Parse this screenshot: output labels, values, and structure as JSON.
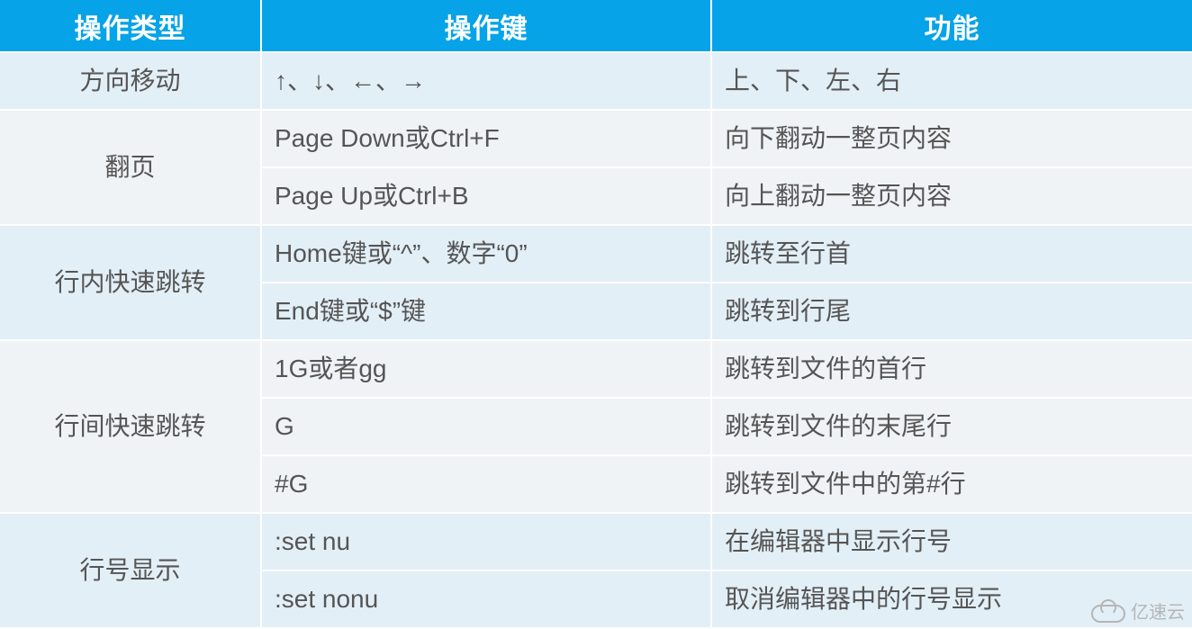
{
  "table": {
    "headers": [
      "操作类型",
      "操作键",
      "功能"
    ],
    "groups": [
      {
        "category": "方向移动",
        "band": "a",
        "rows": [
          {
            "key": "↑、↓、←、→",
            "func": "上、下、左、右"
          }
        ]
      },
      {
        "category": "翻页",
        "band": "b",
        "rows": [
          {
            "key": "Page Down或Ctrl+F",
            "func": "向下翻动一整页内容"
          },
          {
            "key": "Page Up或Ctrl+B",
            "func": "向上翻动一整页内容"
          }
        ]
      },
      {
        "category": "行内快速跳转",
        "band": "a",
        "rows": [
          {
            "key": "Home键或“^”、数字“0”",
            "func": "跳转至行首"
          },
          {
            "key": "End键或“$”键",
            "func": "跳转到行尾"
          }
        ]
      },
      {
        "category": "行间快速跳转",
        "band": "b",
        "rows": [
          {
            "key": "1G或者gg",
            "func": "跳转到文件的首行"
          },
          {
            "key": "G",
            "func": "跳转到文件的末尾行"
          },
          {
            "key": "#G",
            "func": "跳转到文件中的第#行"
          }
        ]
      },
      {
        "category": "行号显示",
        "band": "a",
        "rows": [
          {
            "key": ":set nu",
            "func": "在编辑器中显示行号"
          },
          {
            "key": ":set nonu",
            "func": "取消编辑器中的行号显示"
          }
        ]
      }
    ]
  },
  "watermark": {
    "text": "亿速云"
  }
}
